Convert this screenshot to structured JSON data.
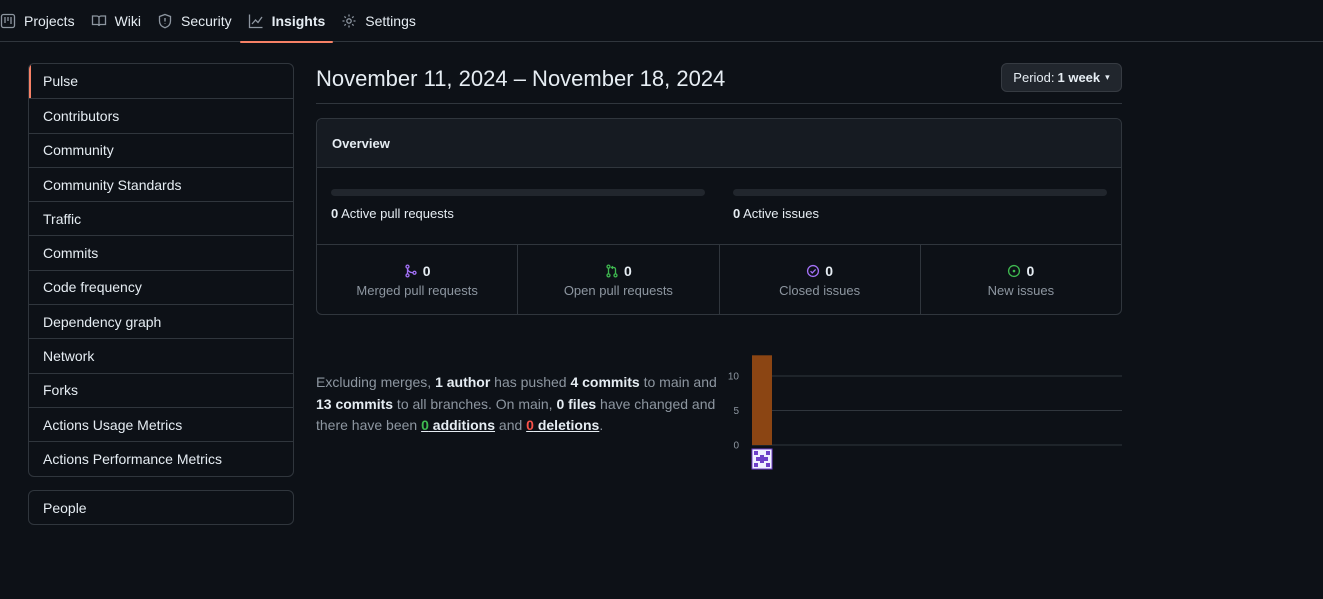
{
  "nav": {
    "items": [
      {
        "label": "Projects",
        "icon": "project-icon"
      },
      {
        "label": "Wiki",
        "icon": "book-icon"
      },
      {
        "label": "Security",
        "icon": "shield-icon"
      },
      {
        "label": "Insights",
        "icon": "graph-icon",
        "active": true
      },
      {
        "label": "Settings",
        "icon": "gear-icon"
      }
    ]
  },
  "sidebar": {
    "items": [
      {
        "label": "Pulse",
        "selected": true
      },
      {
        "label": "Contributors"
      },
      {
        "label": "Community"
      },
      {
        "label": "Community Standards"
      },
      {
        "label": "Traffic"
      },
      {
        "label": "Commits"
      },
      {
        "label": "Code frequency"
      },
      {
        "label": "Dependency graph"
      },
      {
        "label": "Network"
      },
      {
        "label": "Forks"
      },
      {
        "label": "Actions Usage Metrics"
      },
      {
        "label": "Actions Performance Metrics"
      }
    ],
    "people_label": "People"
  },
  "main": {
    "date_range": "November 11, 2024 – November 18, 2024",
    "period_prefix": "Period:",
    "period_value": "1 week",
    "overview": {
      "title": "Overview",
      "active_prs_count": "0",
      "active_prs_label": "Active pull requests",
      "active_issues_count": "0",
      "active_issues_label": "Active issues",
      "stats": [
        {
          "count": "0",
          "label": "Merged pull requests",
          "icon": "git-merge-icon",
          "color": "#a371f7"
        },
        {
          "count": "0",
          "label": "Open pull requests",
          "icon": "git-pull-request-icon",
          "color": "#3fb950"
        },
        {
          "count": "0",
          "label": "Closed issues",
          "icon": "issue-closed-icon",
          "color": "#a371f7"
        },
        {
          "count": "0",
          "label": "New issues",
          "icon": "issue-opened-icon",
          "color": "#3fb950"
        }
      ]
    },
    "summary": {
      "t1": "Excluding merges, ",
      "authors": "1 author",
      "t2": " has pushed ",
      "commits_main": "4 commits",
      "t3": " to main and ",
      "commits_all": "13 commits",
      "t4": " to all branches. On main, ",
      "files": "0 files",
      "t5": " have changed and there have been ",
      "additions_num": "0",
      "additions_word": " additions",
      "t6": " and ",
      "deletions_num": "0",
      "deletions_word": " deletions",
      "t7": "."
    }
  },
  "chart_data": {
    "type": "bar",
    "categories": [
      "author"
    ],
    "values": [
      13
    ],
    "yticks": [
      "10",
      "5",
      "0"
    ],
    "ylim": [
      0,
      13
    ],
    "bar_color": "#8b4513",
    "grid": true
  }
}
